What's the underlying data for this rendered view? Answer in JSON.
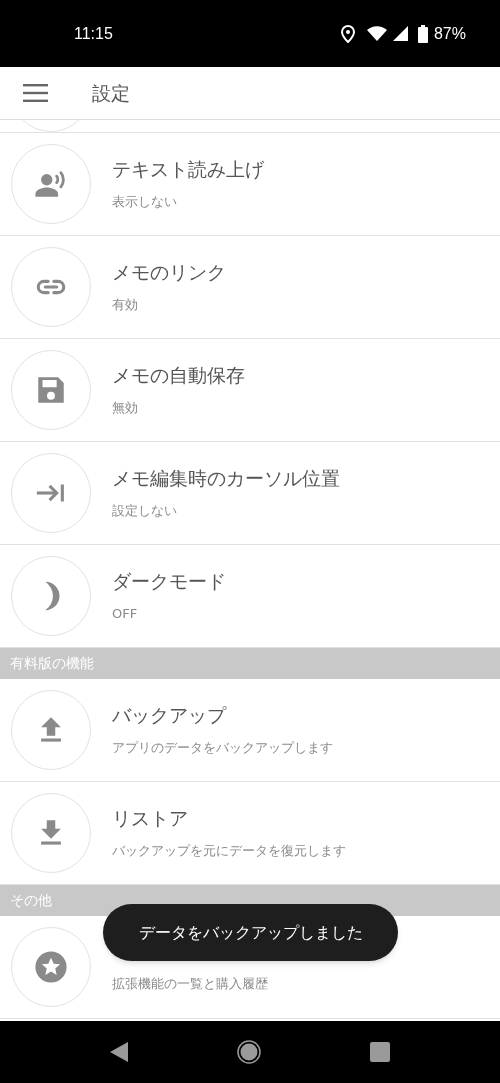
{
  "status_bar": {
    "time": "11:15",
    "battery": "87%"
  },
  "app_bar": {
    "title": "設定"
  },
  "list": [
    {
      "kind": "partial"
    },
    {
      "kind": "item",
      "title": "テキスト読み上げ",
      "subtitle": "表示しない"
    },
    {
      "kind": "item",
      "title": "メモのリンク",
      "subtitle": "有効"
    },
    {
      "kind": "item",
      "title": "メモの自動保存",
      "subtitle": "無効"
    },
    {
      "kind": "item",
      "title": "メモ編集時のカーソル位置",
      "subtitle": "設定しない"
    },
    {
      "kind": "item",
      "title": "ダークモード",
      "subtitle": "OFF"
    },
    {
      "kind": "header",
      "title": "有料版の機能"
    },
    {
      "kind": "item",
      "title": "バックアップ",
      "subtitle": "アプリのデータをバックアップします"
    },
    {
      "kind": "item",
      "title": "リストア",
      "subtitle": "バックアップを元にデータを復元します"
    },
    {
      "kind": "header",
      "title": "その他"
    },
    {
      "kind": "item",
      "subtitle": "拡張機能の一覧と購入履歴"
    }
  ],
  "toast": "データをバックアップしました"
}
